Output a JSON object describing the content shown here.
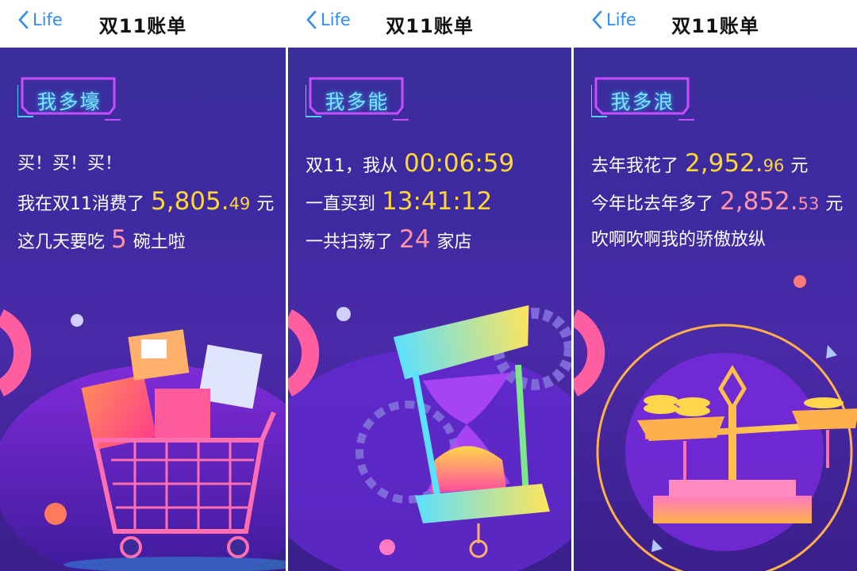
{
  "colors": {
    "accent_blue": "#2f8cf2",
    "highlight_yellow": "#ffd63a",
    "highlight_pink": "#ff93a8",
    "badge_cyan": "#7fe4ff"
  },
  "panels": [
    {
      "nav": {
        "back_label": "Life",
        "title": "双11账单"
      },
      "badge": "我多壕",
      "lines": [
        {
          "pre": "买！买！买！"
        },
        {
          "pre": "我在双11消费了",
          "value_main": "5,805.",
          "value_decimal": "49",
          "post": "元"
        },
        {
          "pre": "这几天要吃",
          "value_main": "5",
          "post": "碗土啦"
        }
      ],
      "illustration": "shopping-cart-illustration"
    },
    {
      "nav": {
        "back_label": "Life",
        "title": "双11账单"
      },
      "badge": "我多能",
      "lines": [
        {
          "pre": "双11，我从",
          "value_main": "00:06:59"
        },
        {
          "pre": "一直买到",
          "value_main": "13:41:12"
        },
        {
          "pre": "一共扫荡了",
          "value_main": "24",
          "post": "家店"
        }
      ],
      "illustration": "hourglass-illustration"
    },
    {
      "nav": {
        "back_label": "Life",
        "title": "双11账单"
      },
      "badge": "我多浪",
      "lines": [
        {
          "pre": "去年我花了",
          "value_main": "2,952.",
          "value_decimal": "96",
          "post": "元"
        },
        {
          "pre": "今年比去年多了",
          "value_main": "2,852.",
          "value_decimal": "53",
          "post": "元"
        },
        {
          "pre": "吹啊吹啊我的骄傲放纵"
        }
      ],
      "illustration": "balance-scale-illustration"
    }
  ]
}
